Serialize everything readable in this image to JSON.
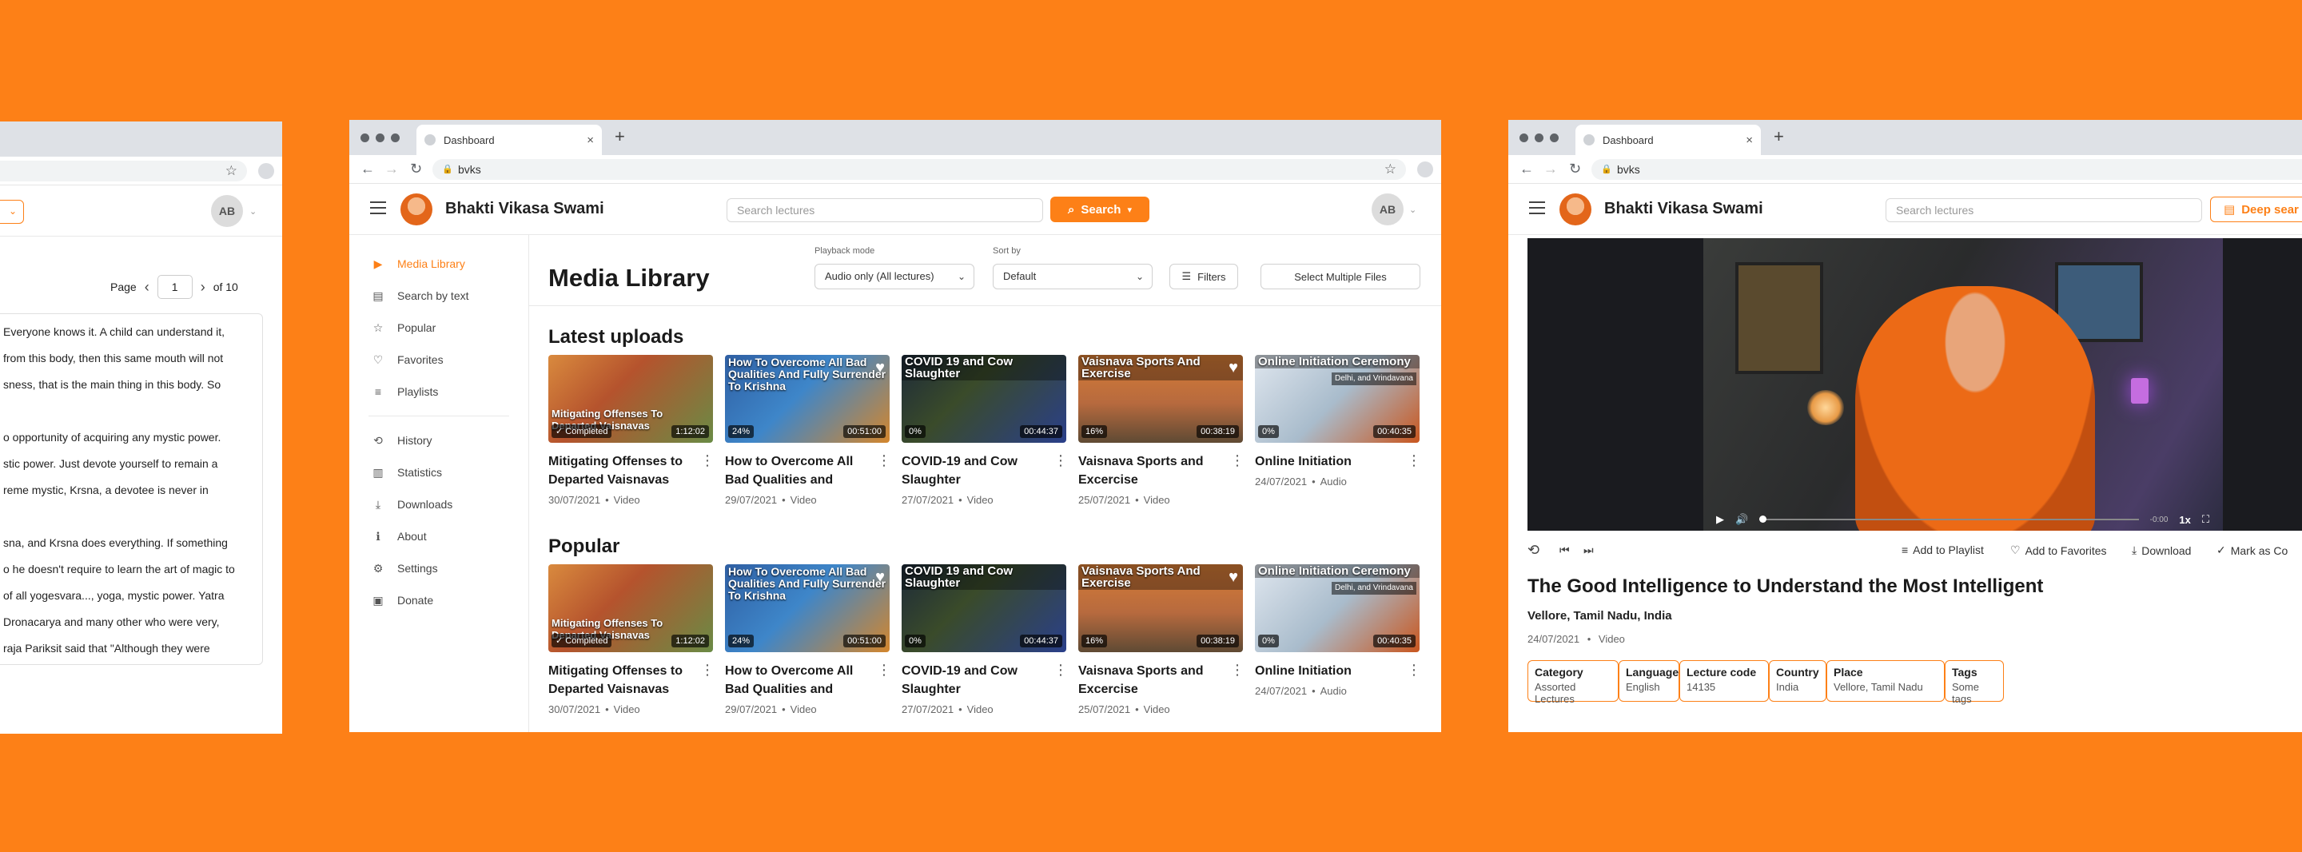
{
  "colors": {
    "accent": "#fd8017",
    "background": "#fd8017"
  },
  "left_window": {
    "avatar": "AB",
    "page_label": "Page",
    "page_value": "1",
    "page_of": "of 10",
    "text_lines": [
      "Everyone knows it. A child can understand it,",
      "from this body, then this same mouth will not",
      "sness, that is the main thing in this body. So",
      "",
      "o opportunity of acquiring any mystic power.",
      "stic power. Just devote yourself to remain a",
      "reme mystic, Krsna, a devotee is never in",
      "",
      "sna, and Krsna does everything. If something",
      "o he doesn't require to learn the art of magic to",
      "of all yogesvara..., yoga, mystic power. Yatra",
      " Dronacarya and many other who were very,",
      "raja Pariksit said that \"Although they were"
    ]
  },
  "center_window": {
    "tab_title": "Dashboard",
    "url": "bvks",
    "brand": "Bhakti Vikasa Swami",
    "search_placeholder": "Search lectures",
    "search_button": "Search",
    "avatar": "AB",
    "sidebar": [
      {
        "label": "Media Library",
        "icon": "media-library-icon"
      },
      {
        "label": "Search by text",
        "icon": "document-search-icon"
      },
      {
        "label": "Popular",
        "icon": "star-icon"
      },
      {
        "label": "Favorites",
        "icon": "heart-icon"
      },
      {
        "label": "Playlists",
        "icon": "playlist-icon"
      },
      {
        "label": "History",
        "icon": "history-icon"
      },
      {
        "label": "Statistics",
        "icon": "statistics-icon"
      },
      {
        "label": "Downloads",
        "icon": "download-icon"
      },
      {
        "label": "About",
        "icon": "info-icon"
      },
      {
        "label": "Settings",
        "icon": "gear-icon"
      },
      {
        "label": "Donate",
        "icon": "gift-icon"
      }
    ],
    "page_title": "Media Library",
    "playback_label": "Playback mode",
    "playback_value": "Audio only (All lectures)",
    "sort_label": "Sort by",
    "sort_value": "Default",
    "filters_button": "Filters",
    "select_multiple_button": "Select Multiple Files",
    "sections": [
      {
        "title": "Latest uploads"
      },
      {
        "title": "Popular"
      }
    ],
    "cards": [
      {
        "title": "Mitigating Offenses to Departed Vaisnavas",
        "date": "30/07/2021",
        "type": "Video",
        "thumb_text": "Mitigating Offenses To Departed Vaisnavas",
        "progress": "Completed",
        "duration": "1:12:02"
      },
      {
        "title": "How to Overcome All Bad Qualities and Full...",
        "date": "29/07/2021",
        "type": "Video",
        "thumb_text": "How To Overcome All Bad Qualities And Fully Surrender To Krishna",
        "progress": "24%",
        "duration": "00:51:00"
      },
      {
        "title": "COVID-19 and Cow Slaughter",
        "date": "27/07/2021",
        "type": "Video",
        "thumb_text": "COVID 19 and Cow Slaughter",
        "progress": "0%",
        "duration": "00:44:37"
      },
      {
        "title": "Vaisnava Sports and Excercise",
        "date": "25/07/2021",
        "type": "Video",
        "thumb_text": "Vaisnava Sports And Exercise",
        "progress": "16%",
        "duration": "00:38:19"
      },
      {
        "title": "Online Initiation",
        "date": "24/07/2021",
        "type": "Audio",
        "thumb_text": "Online Initiation Ceremony",
        "thumb_tag": "Delhi, and Vrindavana",
        "progress": "0%",
        "duration": "00:40:35"
      }
    ],
    "meta_sep": "•"
  },
  "right_window": {
    "tab_title": "Dashboard",
    "url": "bvks",
    "brand": "Bhakti Vikasa Swami",
    "search_placeholder": "Search lectures",
    "deep_search_button": "Deep sear",
    "player": {
      "time": "-0:00",
      "speed": "1x"
    },
    "actions": {
      "playlist": "Add to Playlist",
      "favorites": "Add to Favorites",
      "download": "Download",
      "mark": "Mark as Co"
    },
    "lecture_title": "The Good Intelligence to Understand the Most Intelligent",
    "location": "Vellore, Tamil Nadu, India",
    "date": "24/07/2021",
    "type": "Video",
    "chips": [
      {
        "label": "Category",
        "value": "Assorted Lectures"
      },
      {
        "label": "Language",
        "value": "English"
      },
      {
        "label": "Lecture code",
        "value": "14135"
      },
      {
        "label": "Country",
        "value": "India"
      },
      {
        "label": "Place",
        "value": "Vellore, Tamil Nadu"
      },
      {
        "label": "Tags",
        "value": "Some tags"
      }
    ]
  }
}
